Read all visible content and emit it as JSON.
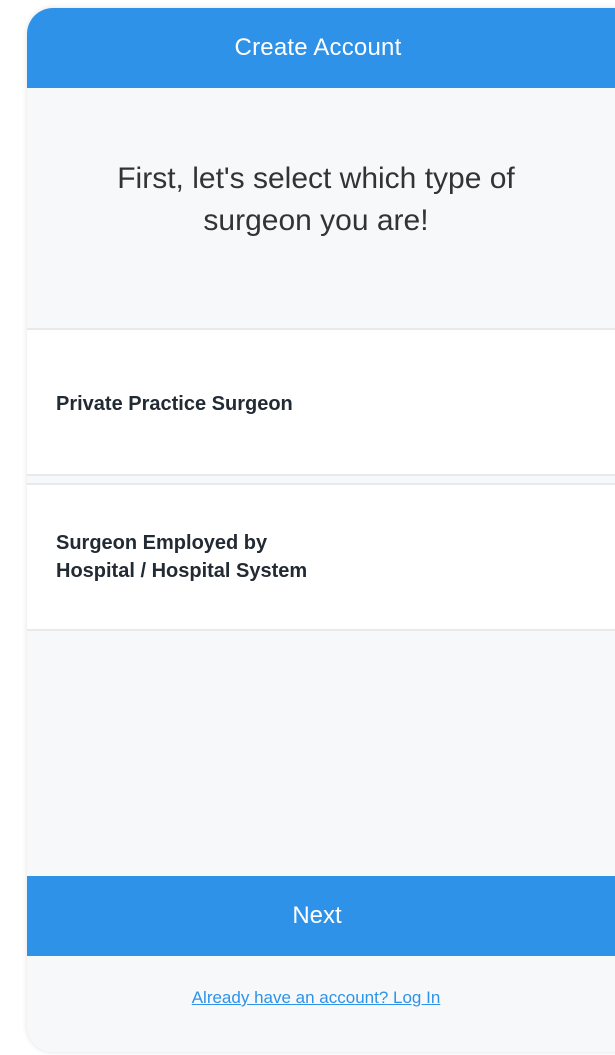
{
  "header": {
    "title": "Create Account"
  },
  "prompt": {
    "line1": "First, let's select which type of",
    "line2": "surgeon you are!"
  },
  "options": [
    {
      "lines": [
        "Private Practice Surgeon"
      ]
    },
    {
      "lines": [
        "Surgeon Employed by",
        "Hospital / Hospital System"
      ]
    }
  ],
  "footer": {
    "next_label": "Next",
    "login_link": "Already have an account? Log In"
  },
  "colors": {
    "accent": "#2e93e8",
    "background": "#f7f8fa",
    "option_background": "#ffffff",
    "text": "#333333"
  }
}
